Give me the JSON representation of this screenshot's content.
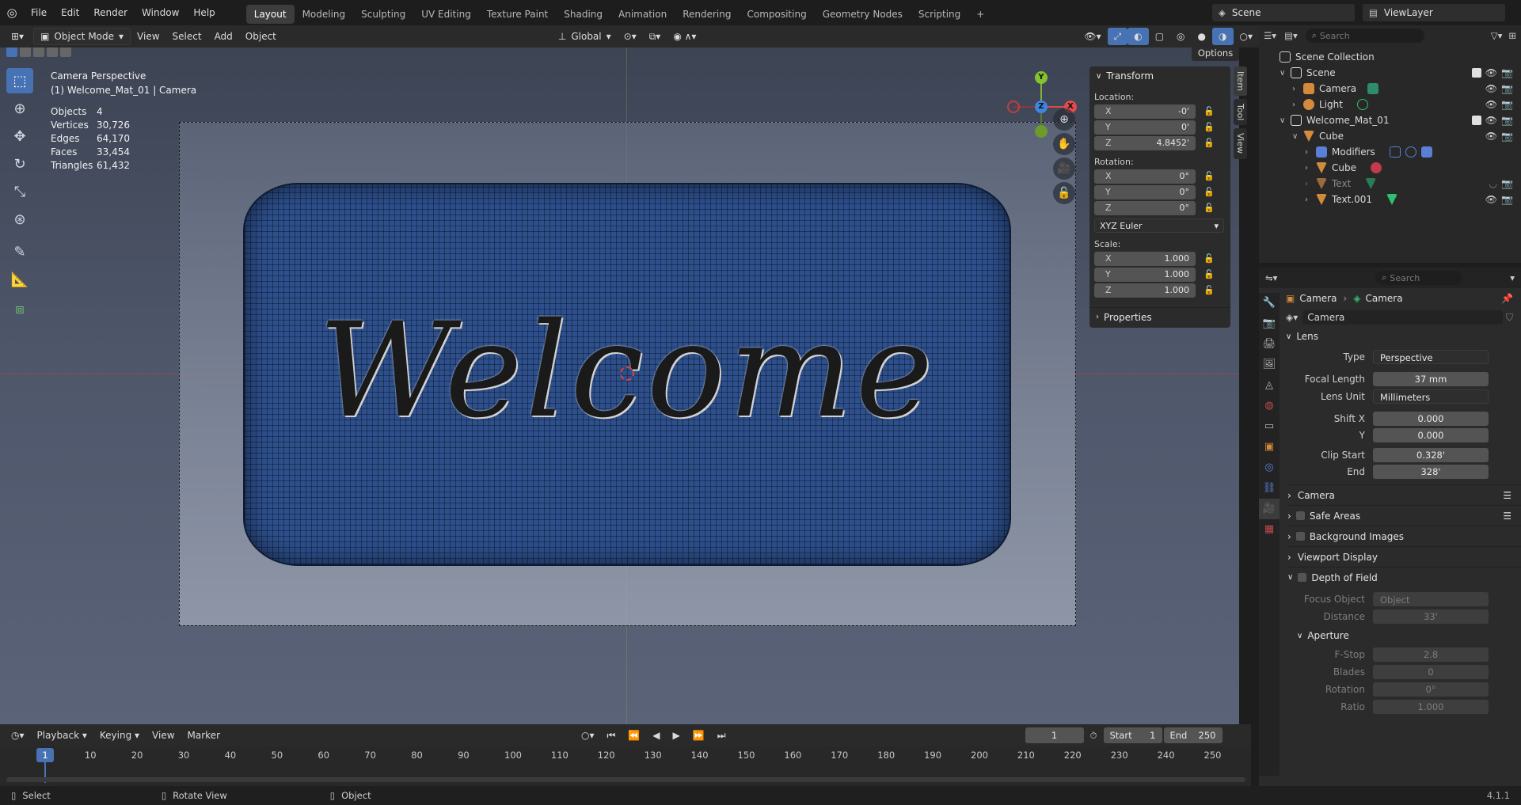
{
  "app": {
    "menus": [
      "File",
      "Edit",
      "Render",
      "Window",
      "Help"
    ],
    "workspaces": [
      "Layout",
      "Modeling",
      "Sculpting",
      "UV Editing",
      "Texture Paint",
      "Shading",
      "Animation",
      "Rendering",
      "Compositing",
      "Geometry Nodes",
      "Scripting"
    ],
    "active_workspace": "Layout",
    "scene": "Scene",
    "view_layer": "ViewLayer",
    "version": "4.1.1"
  },
  "viewport_header": {
    "mode": "Object Mode",
    "menus": [
      "View",
      "Select",
      "Add",
      "Object"
    ],
    "orientation": "Global",
    "options": "Options"
  },
  "overlay": {
    "view_name": "Camera Perspective",
    "object_line": "(1) Welcome_Mat_01 | Camera",
    "stats": [
      {
        "label": "Objects",
        "value": "4"
      },
      {
        "label": "Vertices",
        "value": "30,726"
      },
      {
        "label": "Edges",
        "value": "64,170"
      },
      {
        "label": "Faces",
        "value": "33,454"
      },
      {
        "label": "Triangles",
        "value": "61,432"
      }
    ],
    "mat_text": "Welcome"
  },
  "gizmo": {
    "x": "X",
    "y": "Y",
    "z": "Z"
  },
  "npanel": {
    "title": "Transform",
    "location_label": "Location:",
    "location": {
      "x": "-0'",
      "y": "0'",
      "z": "4.8452'"
    },
    "rotation_label": "Rotation:",
    "rotation": {
      "x": "0°",
      "y": "0°",
      "z": "0°"
    },
    "rotation_mode": "XYZ Euler",
    "scale_label": "Scale:",
    "scale": {
      "x": "1.000",
      "y": "1.000",
      "z": "1.000"
    },
    "properties": "Properties",
    "tabs": [
      "Item",
      "Tool",
      "View"
    ]
  },
  "outliner": {
    "search_placeholder": "Search",
    "root": "Scene Collection",
    "rows": [
      {
        "label": "Scene",
        "indent": 1
      },
      {
        "label": "Camera",
        "indent": 2
      },
      {
        "label": "Light",
        "indent": 2
      },
      {
        "label": "Welcome_Mat_01",
        "indent": 1
      },
      {
        "label": "Cube",
        "indent": 2
      },
      {
        "label": "Modifiers",
        "indent": 3
      },
      {
        "label": "Cube",
        "indent": 3
      },
      {
        "label": "Text",
        "indent": 3
      },
      {
        "label": "Text.001",
        "indent": 3
      }
    ]
  },
  "properties": {
    "search_placeholder": "Search",
    "breadcrumb": [
      "Camera",
      "Camera"
    ],
    "datablock": "Camera",
    "lens_section": "Lens",
    "type_label": "Type",
    "type_value": "Perspective",
    "focal_label": "Focal Length",
    "focal_value": "37 mm",
    "lens_unit_label": "Lens Unit",
    "lens_unit_value": "Millimeters",
    "shift_x_label": "Shift X",
    "shift_x_value": "0.000",
    "shift_y_label": "Y",
    "shift_y_value": "0.000",
    "clip_start_label": "Clip Start",
    "clip_start_value": "0.328'",
    "clip_end_label": "End",
    "clip_end_value": "328'",
    "sections": [
      "Camera",
      "Safe Areas",
      "Background Images",
      "Viewport Display",
      "Depth of Field"
    ],
    "focus_object_label": "Focus Object",
    "focus_object_placeholder": "Object",
    "distance_label": "Distance",
    "distance_value": "33'",
    "aperture_section": "Aperture",
    "fstop_label": "F-Stop",
    "fstop_value": "2.8",
    "blades_label": "Blades",
    "blades_value": "0",
    "rotation_label": "Rotation",
    "rotation_value": "0°",
    "ratio_label": "Ratio",
    "ratio_value": "1.000"
  },
  "timeline": {
    "menus": [
      "Playback",
      "Keying",
      "View",
      "Marker"
    ],
    "current_frame": "1",
    "start_label": "Start",
    "start_value": "1",
    "end_label": "End",
    "end_value": "250",
    "ticks": [
      "10",
      "20",
      "30",
      "40",
      "50",
      "60",
      "70",
      "80",
      "90",
      "100",
      "110",
      "120",
      "130",
      "140",
      "150",
      "160",
      "170",
      "180",
      "190",
      "200",
      "210",
      "220",
      "230",
      "240",
      "250"
    ]
  },
  "statusbar": {
    "select": "Select",
    "rotate": "Rotate View",
    "object": "Object"
  },
  "colors": {
    "accent": "#4772b3",
    "mat_blue": "#2d4f8c",
    "active_tab_green": "#2fbf71"
  }
}
